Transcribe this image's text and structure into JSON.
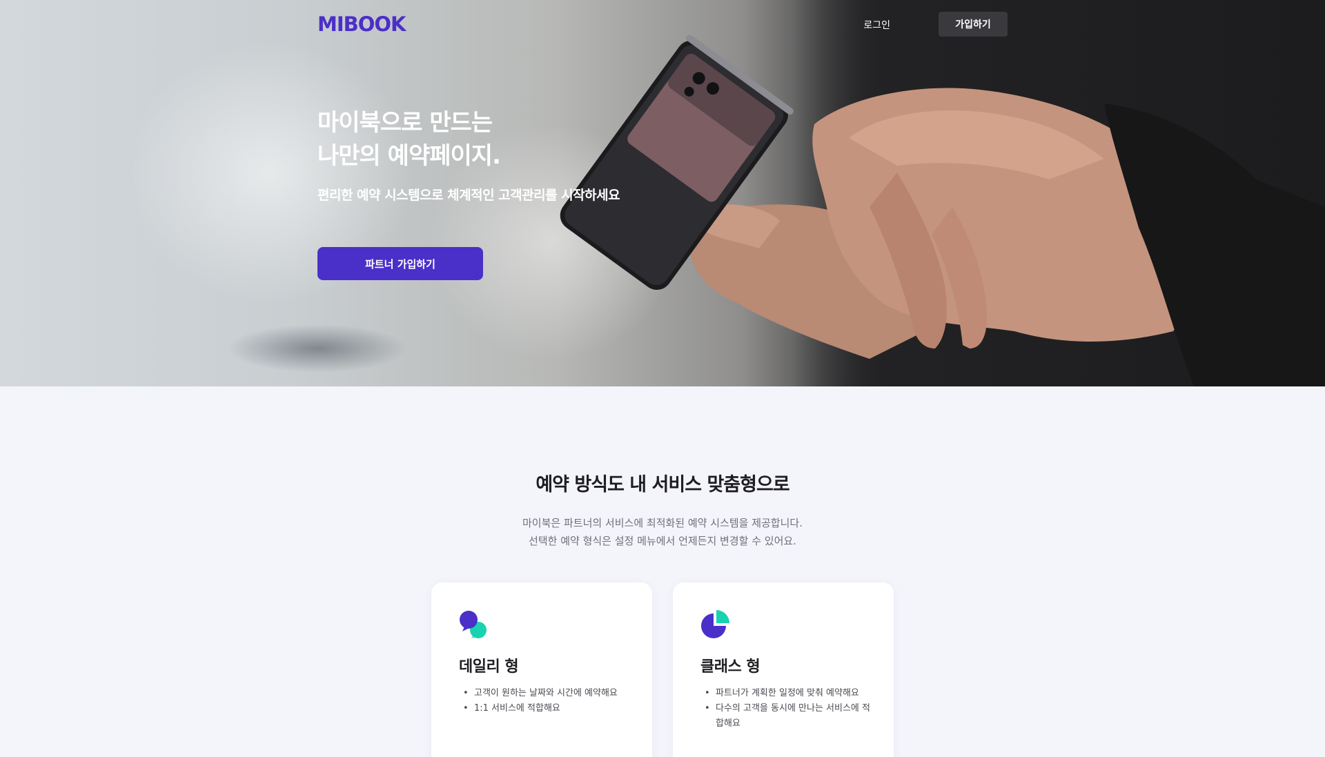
{
  "header": {
    "logo": "MIBOOK",
    "login_label": "로그인",
    "signup_label": "가입하기"
  },
  "hero": {
    "title_line1": "마이북으로 만드는",
    "title_line2": "나만의 예약페이지.",
    "subtitle": "편리한 예약 시스템으로 체계적인 고객관리를 시작하세요",
    "cta_label": "파트너 가입하기"
  },
  "section": {
    "title": "예약 방식도 내 서비스 맞춤형으로",
    "desc_line1": "마이북은 파트너의 서비스에 최적화된 예약 시스템을 제공합니다.",
    "desc_line2": "선택한 예약 형식은 설정 메뉴에서 언제든지 변경할 수 있어요."
  },
  "cards": [
    {
      "icon": "chat-bubbles-icon",
      "title": "데일리 형",
      "items": [
        "고객이 원하는 날짜와 시간에 예약해요",
        "1:1 서비스에 적합해요"
      ]
    },
    {
      "icon": "pie-chart-icon",
      "title": "클래스 형",
      "items": [
        "파트너가 계획한 일정에 맞춰 예약해요",
        "다수의 고객을 동시에 만나는 서비스에 적합해요"
      ]
    }
  ],
  "colors": {
    "brand": "#4b2fc9",
    "accent": "#19d3b0",
    "background": "#f4f4fb",
    "dark_button": "#3a3a3e"
  }
}
